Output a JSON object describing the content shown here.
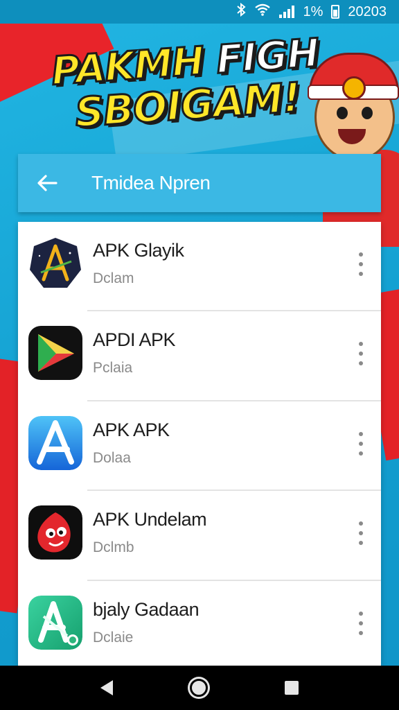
{
  "status_bar": {
    "bluetooth_icon": "bluetooth-icon",
    "wifi_icon": "wifi-icon",
    "signal_icon": "signal-icon",
    "battery_text": "1%",
    "battery_icon": "battery-icon",
    "time": "20203"
  },
  "banner": {
    "line1_a": "PAKMH",
    "line1_b": "FIGH",
    "line2": "SBOIGAM!"
  },
  "app_bar": {
    "back_icon": "arrow-left-icon",
    "title": "Tmidea Npren"
  },
  "apps": [
    {
      "name": "APK Glayik",
      "subtitle": "Dclam",
      "icon": "archer-icon"
    },
    {
      "name": "APDI APK",
      "subtitle": "Pclaia",
      "icon": "play-triangle-icon"
    },
    {
      "name": "APK APK",
      "subtitle": "Dolaa",
      "icon": "letter-a-icon"
    },
    {
      "name": "APK Undelam",
      "subtitle": "Dclmb",
      "icon": "red-face-icon"
    },
    {
      "name": "bjaly Gadaan",
      "subtitle": "Dclaie",
      "icon": "green-a-icon"
    }
  ],
  "nav_bar": {
    "back": "nav-back-icon",
    "home": "nav-home-icon",
    "recents": "nav-recents-icon"
  },
  "colors": {
    "app_bar": "#3bb8e4",
    "background": "#1aa7d6",
    "accent_red": "#e32227",
    "banner_yellow": "#ffe629"
  }
}
